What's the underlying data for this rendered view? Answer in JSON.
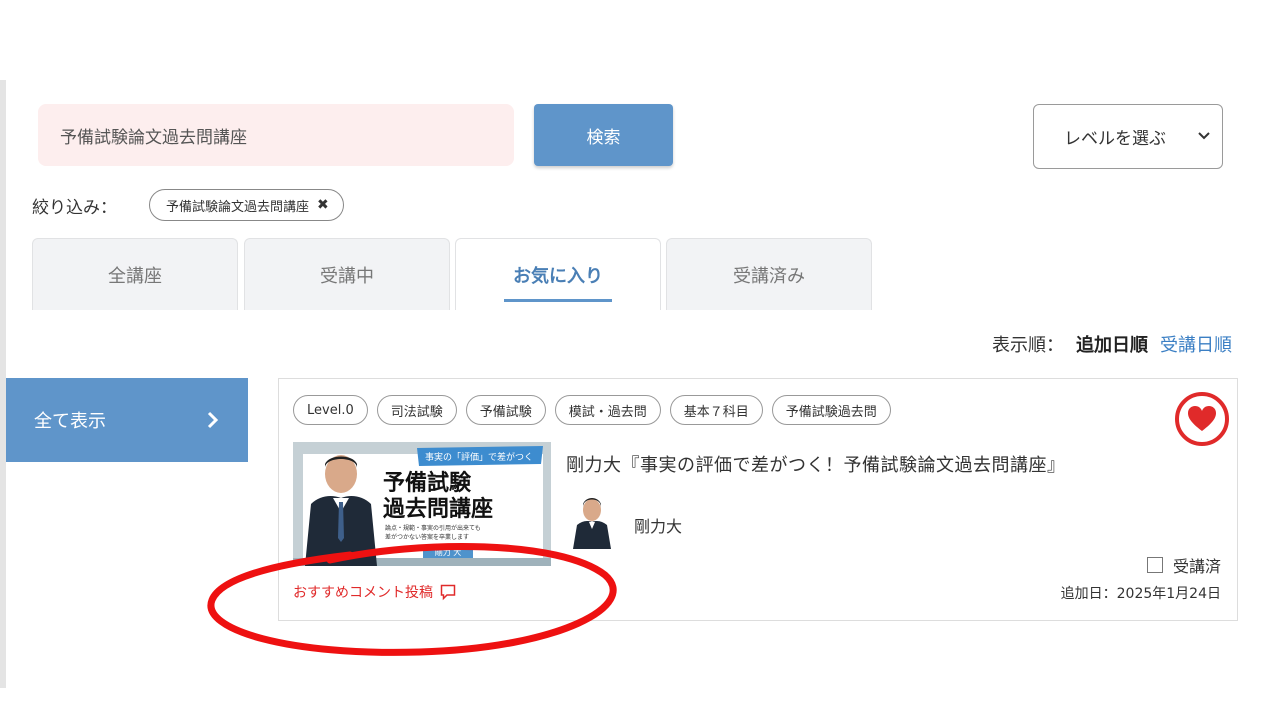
{
  "search": {
    "value": "予備試験論文過去問講座",
    "button_label": "検索"
  },
  "level_select": {
    "selected": "レベルを選ぶ"
  },
  "filter": {
    "label": "絞り込み：",
    "chip": "予備試験論文過去問講座",
    "chip_remove": "✖"
  },
  "tabs": [
    {
      "label": "全講座"
    },
    {
      "label": "受講中"
    },
    {
      "label": "お気に入り"
    },
    {
      "label": "受講済み"
    }
  ],
  "sort": {
    "label": "表示順：",
    "options": [
      "追加日順",
      "受講日順"
    ]
  },
  "sidebar": {
    "show_all": "全て表示"
  },
  "course": {
    "tags": [
      "Level.0",
      "司法試験",
      "予備試験",
      "模試・過去問",
      "基本７科目",
      "予備試験過去問"
    ],
    "title": "剛力大『事実の評価で差がつく！予備試験論文過去問講座』",
    "author": "剛力大",
    "thumbnail": {
      "banner": "事実の「評価」で差がつく",
      "line1": "予備試験",
      "line2": "過去問講座",
      "sub1": "論点・規範・事実の引用が出来ても",
      "sub2": "差がつかない答案を卒業します",
      "name": "剛力 大"
    },
    "done_label": "受講済",
    "added_date": "追加日：2025年1月24日",
    "comment_link": "おすすめコメント投稿",
    "favorite": true
  },
  "colors": {
    "accent": "#5f95ca",
    "heart": "#e02a2a",
    "annotation": "#ee1111"
  }
}
